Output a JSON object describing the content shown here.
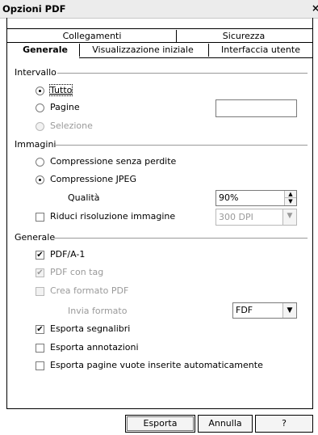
{
  "window": {
    "title": "Opzioni PDF",
    "close_icon": "×"
  },
  "tabs": {
    "row1": [
      {
        "label": "Collegamenti"
      },
      {
        "label": "Sicurezza"
      }
    ],
    "row2": [
      {
        "label": "Generale",
        "selected": true
      },
      {
        "label": "Visualizzazione iniziale"
      },
      {
        "label": "Interfaccia utente"
      }
    ]
  },
  "range": {
    "heading": "Intervallo",
    "all": {
      "label": "Tutto",
      "checked": true
    },
    "pages": {
      "label": "Pagine",
      "checked": false,
      "value": ""
    },
    "selection": {
      "label": "Selezione",
      "checked": false,
      "disabled": true
    }
  },
  "images": {
    "heading": "Immagini",
    "lossless": {
      "label": "Compressione senza perdite",
      "checked": false
    },
    "jpeg": {
      "label": "Compressione JPEG",
      "checked": true
    },
    "quality": {
      "label": "Qualità",
      "value": "90%"
    },
    "reduce": {
      "label": "Riduci risoluzione immagine",
      "checked": false,
      "value": "300 DPI",
      "disabled_value": true
    }
  },
  "general": {
    "heading": "Generale",
    "pdfa": {
      "label": "PDF/A-1",
      "checked": true
    },
    "tagged": {
      "label": "PDF con tag",
      "checked": true,
      "disabled": true
    },
    "create_form": {
      "label": "Crea formato PDF",
      "checked": false,
      "disabled": true
    },
    "submit_format": {
      "label": "Invia formato",
      "value": "FDF",
      "disabled": true
    },
    "bookmarks": {
      "label": "Esporta segnalibri",
      "checked": true
    },
    "notes": {
      "label": "Esporta annotazioni",
      "checked": false
    },
    "blank_pages": {
      "label": "Esporta pagine vuote inserite automaticamente",
      "checked": false
    }
  },
  "buttons": {
    "export": "Esporta",
    "cancel": "Annulla",
    "help": "?"
  },
  "icons": {
    "check_glyph": "✔",
    "arrow_up": "▲",
    "arrow_down": "▼"
  }
}
